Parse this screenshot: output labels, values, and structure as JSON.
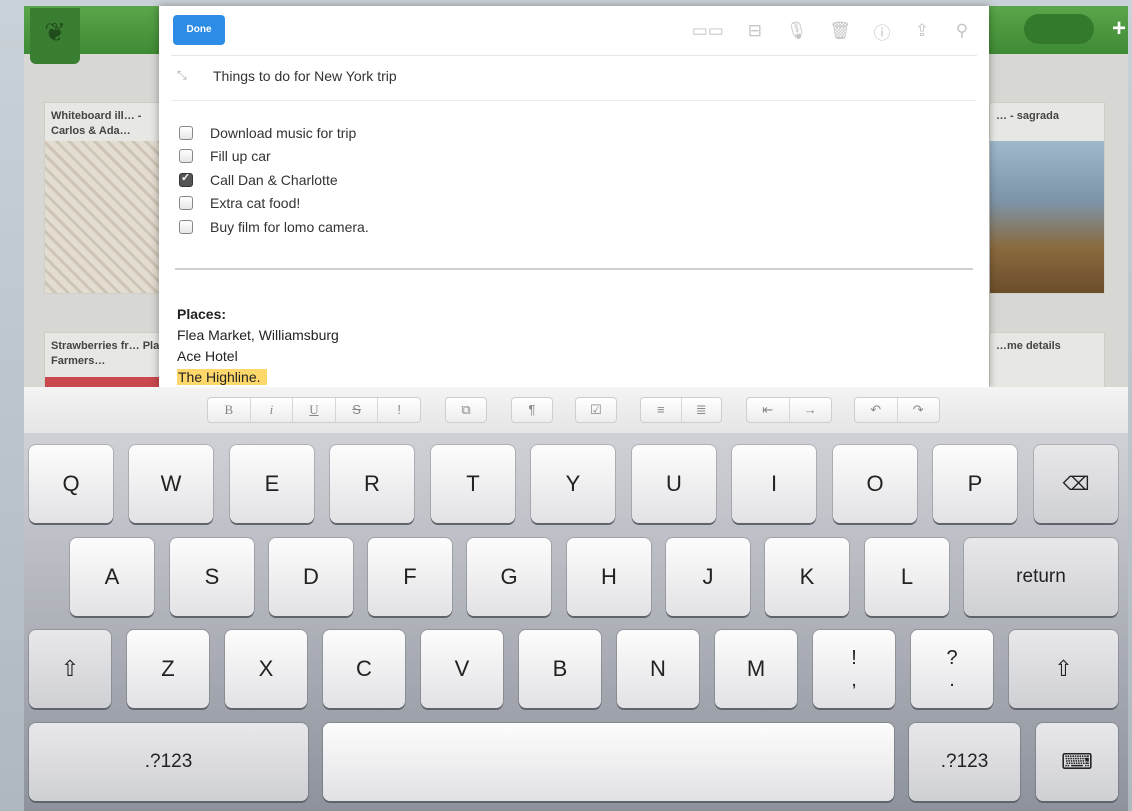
{
  "background": {
    "cards": [
      {
        "title": "Whiteboard ill… - Carlos & Ada…"
      },
      {
        "title": "… - sagrada"
      },
      {
        "title": "Strawberries fr… Plaza Farmers…"
      },
      {
        "title": "…me details"
      }
    ],
    "add_label": "+"
  },
  "note": {
    "done_label": "Done",
    "title": "Things to do for New York trip",
    "toolbar_icons": [
      "camera-icon",
      "projector-icon",
      "microphone-icon",
      "trash-icon",
      "info-icon",
      "share-icon",
      "search-icon"
    ],
    "checklist": [
      {
        "label": "Download music for trip",
        "checked": false
      },
      {
        "label": "Fill up car",
        "checked": false
      },
      {
        "label": "Call Dan & Charlotte",
        "checked": true
      },
      {
        "label": "Extra cat food!",
        "checked": false
      },
      {
        "label": "Buy film for lomo camera.",
        "checked": false
      }
    ],
    "places_heading": "Places:",
    "places": [
      "Flea Market, Williamsburg",
      "Ace Hotel",
      "The Highline."
    ],
    "highlighted_color": "#ffd86b"
  },
  "format_bar": {
    "text_style": [
      "B",
      "i",
      "U",
      "S",
      "!"
    ],
    "link": "⧉",
    "paragraph": "¶",
    "checkbox": "☑",
    "lists": [
      "≡",
      "≣"
    ],
    "indent": [
      "⇤",
      "→"
    ],
    "history": [
      "↶",
      "↷"
    ]
  },
  "keyboard": {
    "row1": [
      "Q",
      "W",
      "E",
      "R",
      "T",
      "Y",
      "U",
      "I",
      "O",
      "P"
    ],
    "row2": [
      "A",
      "S",
      "D",
      "F",
      "G",
      "H",
      "J",
      "K",
      "L"
    ],
    "row3": [
      "Z",
      "X",
      "C",
      "V",
      "B",
      "N",
      "M"
    ],
    "punct1": {
      "top": "!",
      "bottom": ","
    },
    "punct2": {
      "top": "?",
      "bottom": "."
    },
    "backspace": "⌫",
    "return_label": "return",
    "shift": "⇧",
    "num_label": ".?123",
    "hide_keyboard": "⌨"
  }
}
